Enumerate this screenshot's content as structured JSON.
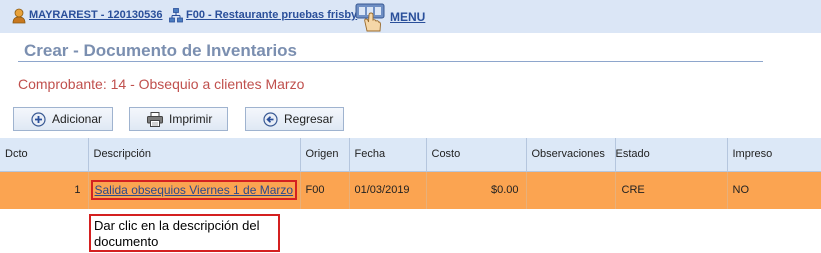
{
  "topbar": {
    "user_label": "MAYRAREST - 120130536",
    "company_label": "F00 - Restaurante pruebas frisby",
    "menu_label": "MENU"
  },
  "page": {
    "title": "Crear - Documento de Inventarios",
    "comprobante": "Comprobante: 14 - Obsequio a clientes Marzo"
  },
  "toolbar": {
    "add_label": "Adicionar",
    "print_label": "Imprimir",
    "back_label": "Regresar"
  },
  "grid": {
    "columns": [
      "Dcto",
      "Descripción",
      "Origen",
      "Fecha",
      "Costo",
      "Observaciones",
      "Estado",
      "Impreso"
    ],
    "rows": [
      {
        "dcto": "1",
        "descripcion": "Salida obsequios Viernes 1 de Marzo",
        "origen": "F00",
        "fecha": "01/03/2019",
        "costo": "$0.00",
        "observaciones": "",
        "estado": "CRE",
        "impreso": "NO"
      }
    ]
  },
  "annotation": {
    "note": "Dar clic en la descripción del documento"
  },
  "colors": {
    "row_highlight": "#fba451",
    "header_bg": "#dce8f7",
    "title": "#7b8fb0",
    "comprobante": "#c0504d",
    "callout_border": "#d42020"
  }
}
